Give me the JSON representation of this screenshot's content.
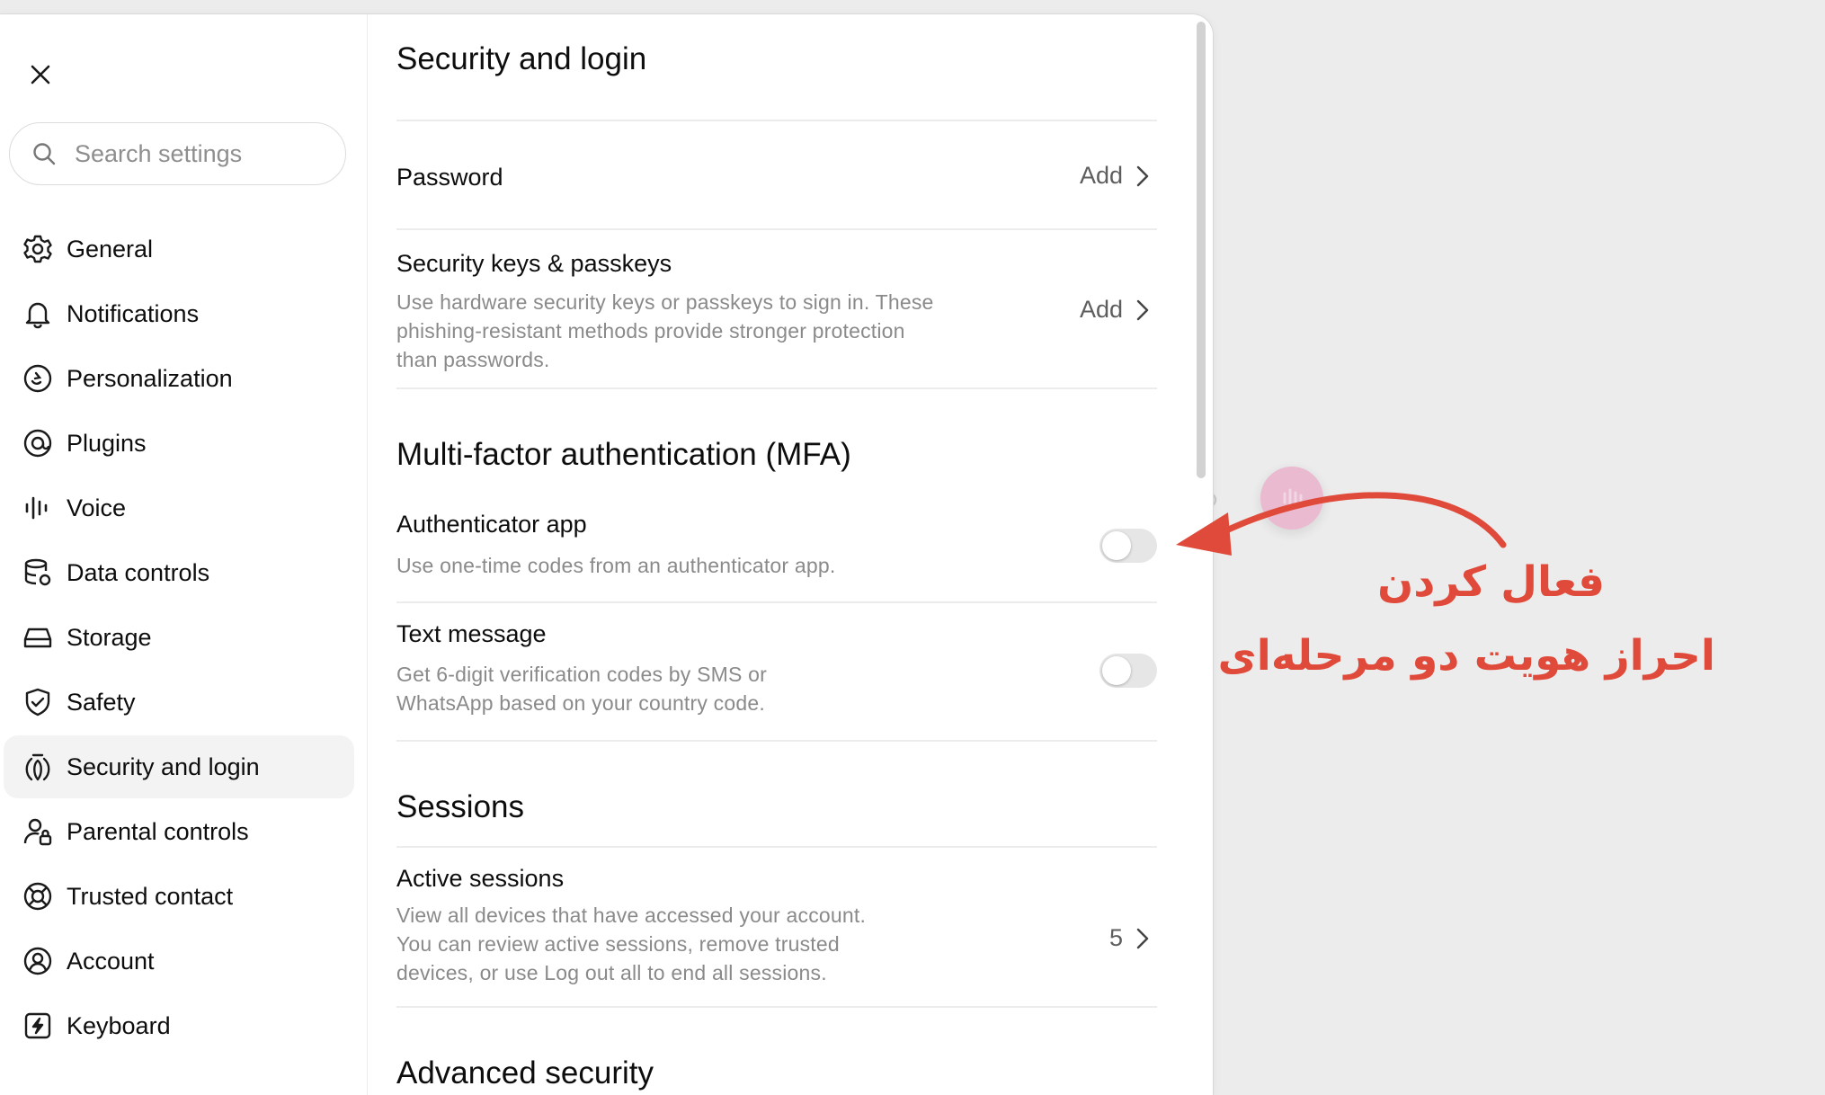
{
  "search": {
    "placeholder": "Search settings"
  },
  "sidebar": {
    "items": [
      {
        "label": "General",
        "icon": "gear-icon"
      },
      {
        "label": "Notifications",
        "icon": "bell-icon"
      },
      {
        "label": "Personalization",
        "icon": "personalization-icon"
      },
      {
        "label": "Plugins",
        "icon": "plugins-icon"
      },
      {
        "label": "Voice",
        "icon": "voice-waveform-icon"
      },
      {
        "label": "Data controls",
        "icon": "database-gear-icon"
      },
      {
        "label": "Storage",
        "icon": "storage-drive-icon"
      },
      {
        "label": "Safety",
        "icon": "shield-check-icon"
      },
      {
        "label": "Security and login",
        "icon": "security-key-icon",
        "active": true
      },
      {
        "label": "Parental controls",
        "icon": "user-lock-icon"
      },
      {
        "label": "Trusted contact",
        "icon": "lifebuoy-icon"
      },
      {
        "label": "Account",
        "icon": "user-circle-icon"
      },
      {
        "label": "Keyboard",
        "icon": "keyboard-bolt-icon"
      }
    ]
  },
  "main": {
    "title": "Security and login",
    "password": {
      "title": "Password",
      "action": "Add"
    },
    "keys": {
      "title": "Security keys & passkeys",
      "desc1": "Use hardware security keys or passkeys to sign in. These",
      "desc2": "phishing-resistant methods provide stronger protection",
      "desc3": "than passwords.",
      "action": "Add"
    },
    "mfa": {
      "title": "Multi-factor authentication (MFA)",
      "authenticator": {
        "title": "Authenticator app",
        "desc": "Use one-time codes from an authenticator app.",
        "enabled": false
      },
      "sms": {
        "title": "Text message",
        "desc1": "Get 6-digit verification codes by SMS or",
        "desc2": "WhatsApp based on your country code.",
        "enabled": false
      }
    },
    "sessions": {
      "title": "Sessions",
      "active": {
        "title": "Active sessions",
        "desc1": "View all devices that have accessed your account.",
        "desc2": "You can review active sessions, remove trusted",
        "desc3": "devices, or use Log out all to end all sessions.",
        "count": "5"
      }
    },
    "advanced": {
      "title": "Advanced security"
    }
  },
  "annotation": {
    "line1": "فعال کردن",
    "line2": "احراز هویت دو مرحله‌ای",
    "color": "#e04a3a"
  },
  "colors": {
    "accent_annotation": "#e04a3a",
    "active_bg": "#f3f3f3",
    "toggle_off": "#e6e6e6"
  }
}
